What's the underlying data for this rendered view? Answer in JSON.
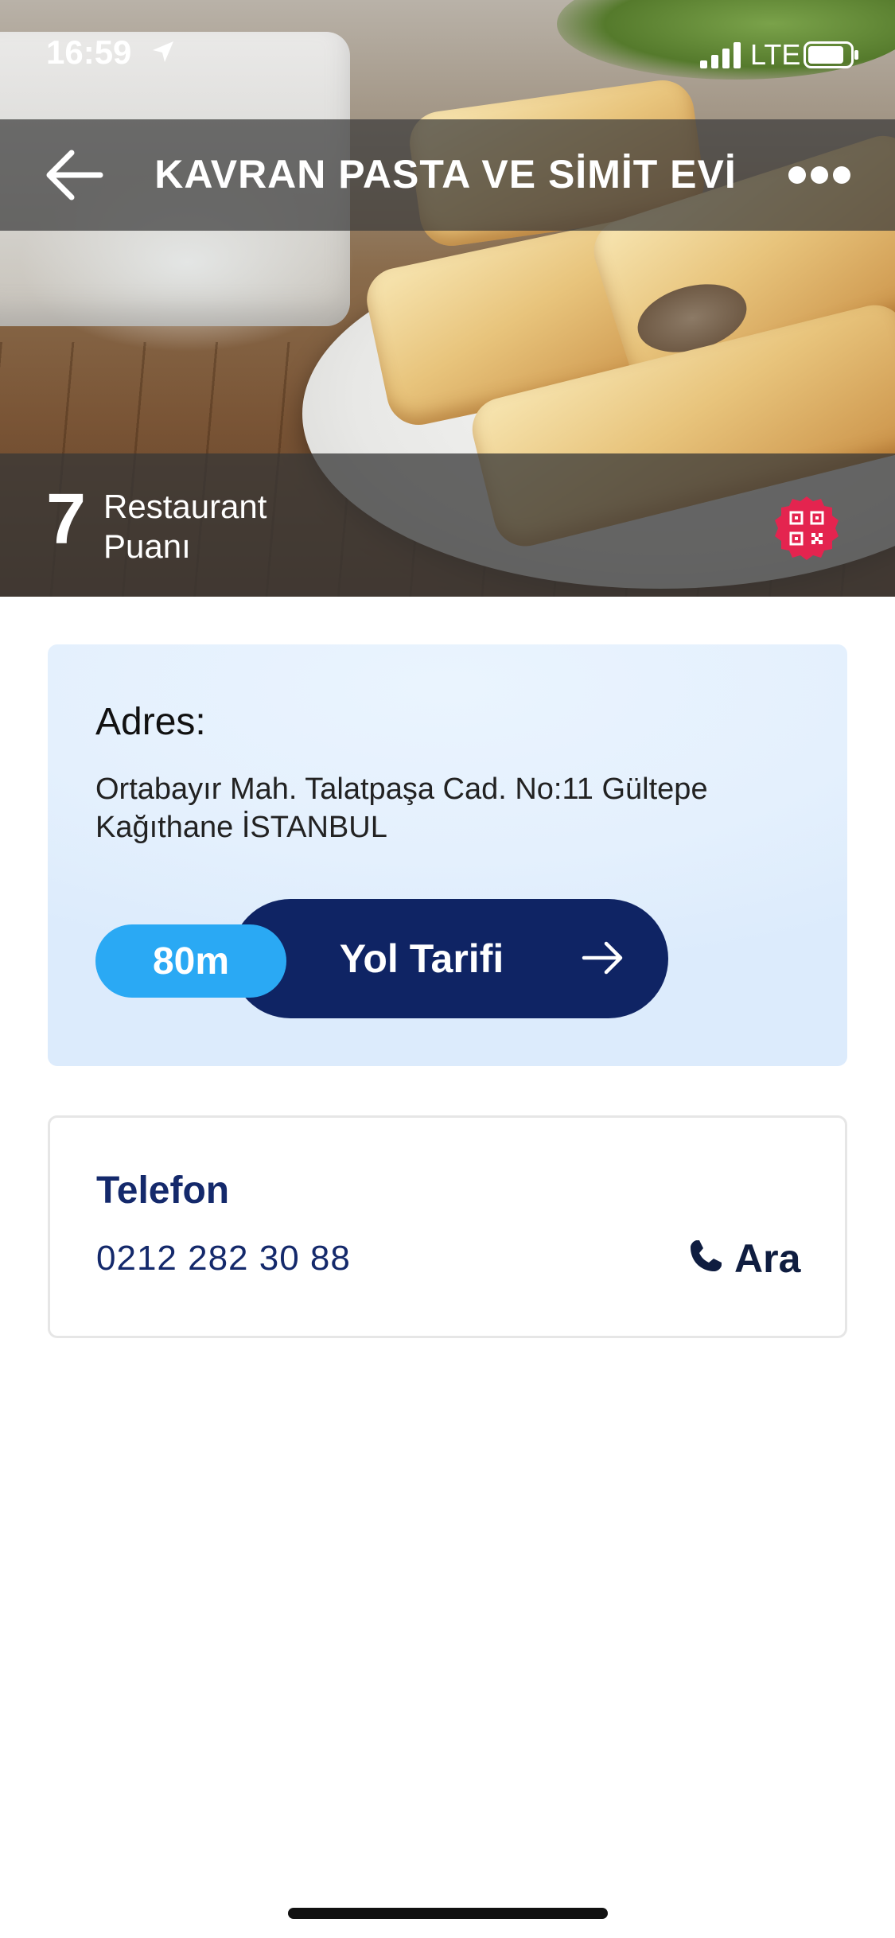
{
  "status_bar": {
    "time": "16:59",
    "network": "LTE"
  },
  "nav": {
    "title": "KAVRAN PASTA VE SİMİT EVİ"
  },
  "rating": {
    "value": "7",
    "label": "Restaurant Puanı"
  },
  "address": {
    "heading": "Adres:",
    "text": "Ortabayır Mah. Talatpaşa Cad.  No:11 Gültepe Kağıthane İSTANBUL",
    "distance": "80m",
    "directions_label": "Yol Tarifi"
  },
  "phone": {
    "heading": "Telefon",
    "number": "0212 282 30 88",
    "call_label": "Ara"
  },
  "colors": {
    "navy": "#0f2464",
    "accent_blue": "#2aa9f4",
    "card_bg": "#e4f0fd",
    "qr_red": "#e4244f"
  },
  "icons": [
    "location-arrow-icon",
    "signal-icon",
    "battery-icon",
    "back-arrow-icon",
    "more-icon",
    "qr-code-icon",
    "arrow-right-icon",
    "phone-icon"
  ]
}
